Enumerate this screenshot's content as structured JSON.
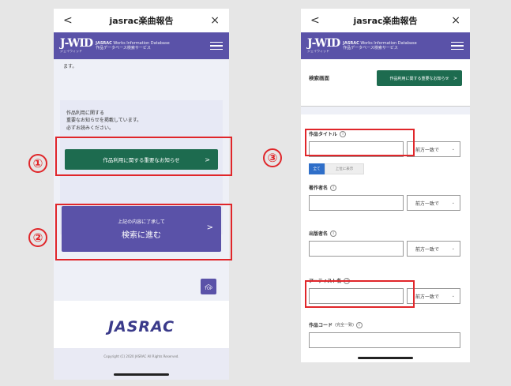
{
  "left_phone": {
    "nav_back": "<",
    "title": "jasrac楽曲報告",
    "nav_close": "×",
    "brand_logo": "J-WID",
    "brand_org": "JASRAC",
    "brand_en": "Works Information Database",
    "brand_jp": "作品データベース検索サービス",
    "brand_kana": "ジェイウィッド",
    "cut_text": "ます。",
    "notice_lines": [
      "作品利用に関する",
      "重要なお知らせを掲載しています。",
      "必ずお読みください。"
    ],
    "important_notice_button": "作品利用に関する重要なお知らせ",
    "proceed_line1": "上記の内容に了承して",
    "proceed_line2": "検索に進む",
    "chevron": ">",
    "top_label": "TOP",
    "footer_logo": "JASRAC",
    "copyright": "Copyright (C) 2020 JASRAC All Rights Reserved."
  },
  "right_phone": {
    "nav_back": "<",
    "title": "jasrac楽曲報告",
    "nav_close": "×",
    "brand_logo": "J-WID",
    "brand_org": "JASRAC",
    "brand_en": "Works Information Database",
    "brand_jp": "作品データベース検索サービス",
    "brand_kana": "ジェイウィッド",
    "search_label": "検索画面",
    "important_notice_button": "作品利用に関する重要なお知らせ",
    "chevron": ">",
    "work_title_label": "作品タイトル",
    "info_mark": "i",
    "match_option": "前方一致で",
    "dropdown_mark": "⌄",
    "toggle_all": "全て",
    "toggle_prefix": "上位に表示",
    "author_label": "著作者名",
    "publisher_label": "出版者名",
    "artist_label": "アーティスト名",
    "work_code_label": "作品コード",
    "work_code_note": "(完全一致)"
  },
  "annotations": {
    "marker_1": "①",
    "marker_2": "②",
    "marker_3": "③",
    "highlight_color": "#e0262a"
  },
  "colors": {
    "brand_purple": "#5a52a8",
    "notice_green": "#1d6b4f",
    "toggle_blue": "#2f6fc9"
  }
}
